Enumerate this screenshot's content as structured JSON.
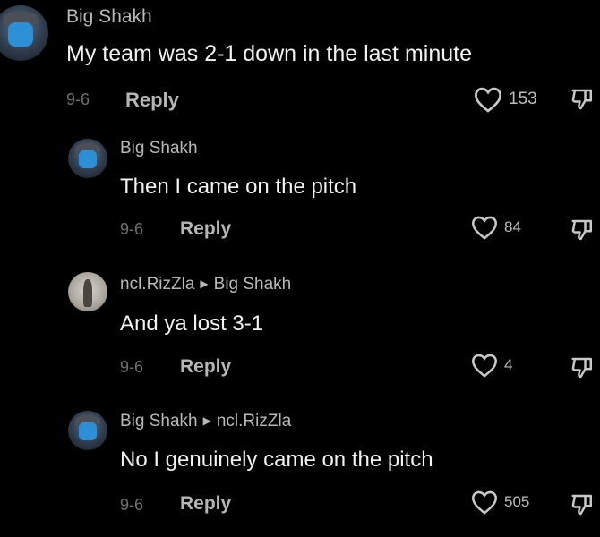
{
  "comments": [
    {
      "username": "Big Shakh",
      "reply_to": "",
      "text": "My team was 2-1 down in the last minute",
      "date": "9-6",
      "reply_label": "Reply",
      "likes": "153",
      "avatar": "big-shakh"
    },
    {
      "username": "Big Shakh",
      "reply_to": "",
      "text": "Then I came on the pitch",
      "date": "9-6",
      "reply_label": "Reply",
      "likes": "84",
      "avatar": "big-shakh"
    },
    {
      "username": "ncl.RizZla",
      "reply_to": "Big Shakh",
      "text": "And ya lost 3-1",
      "date": "9-6",
      "reply_label": "Reply",
      "likes": "4",
      "avatar": "ncl-rizzla"
    },
    {
      "username": "Big Shakh",
      "reply_to": "ncl.RizZla",
      "text": "No I genuinely came on the pitch",
      "date": "9-6",
      "reply_label": "Reply",
      "likes": "505",
      "avatar": "big-shakh"
    }
  ],
  "icons": {
    "like": "heart-outline-icon",
    "dislike": "thumbs-down-icon",
    "reply_arrow": "triangle-right-icon"
  },
  "colors": {
    "background": "#000000",
    "text": "#f2f2f2",
    "muted": "#6f6f6f",
    "username": "#b9b9b9"
  }
}
